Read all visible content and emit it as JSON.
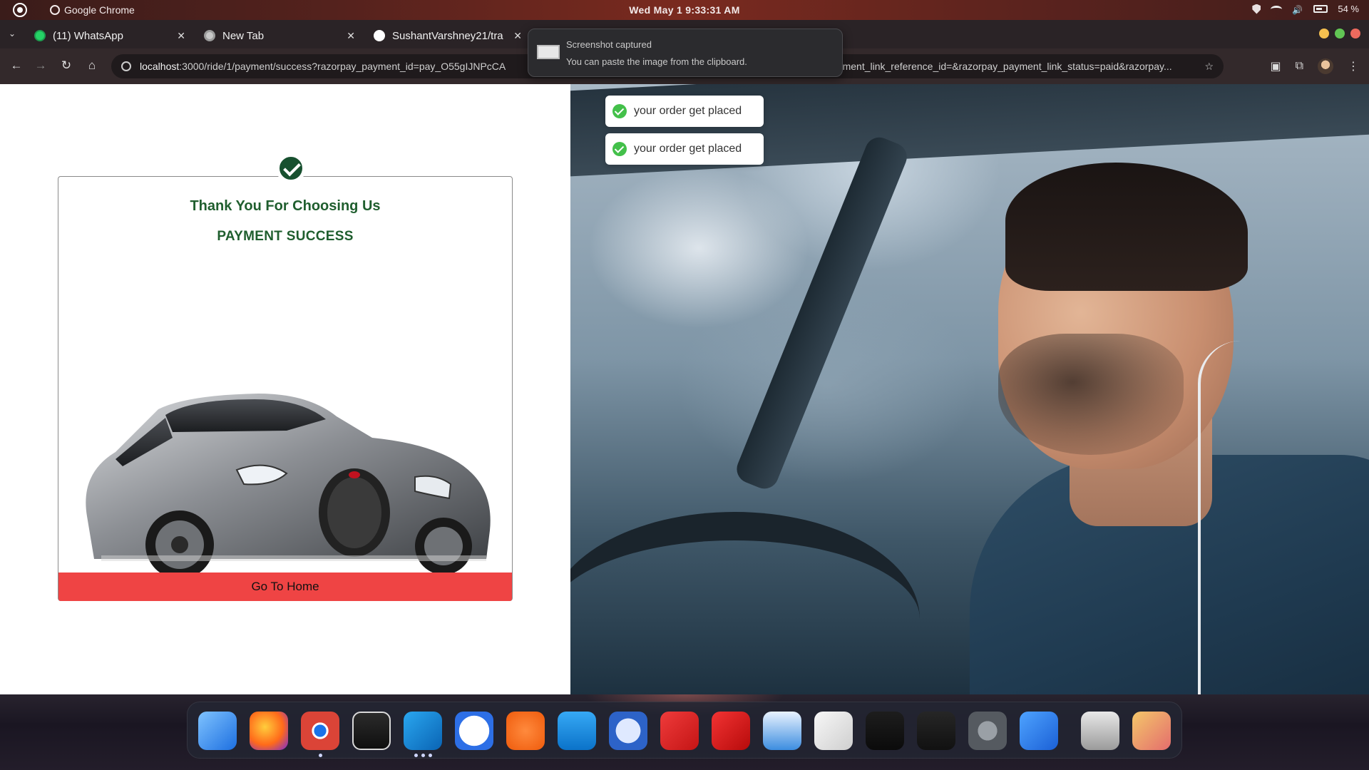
{
  "os_bar": {
    "app_name": "Google Chrome",
    "clock": "Wed May 1  9:33:31 AM",
    "battery": "54 %"
  },
  "tabs": [
    {
      "title": "(11) WhatsApp",
      "icon": "whatsapp-icon"
    },
    {
      "title": "New Tab",
      "icon": "chrome-icon"
    },
    {
      "title": "SushantVarshney21/tra",
      "icon": "github-icon"
    }
  ],
  "address_bar": {
    "url_host": "localhost",
    "url_path_start": ":3000/ride/1/payment/success?razorpay_payment_id=pay_O55gIJNPcCA",
    "url_path_end": "_payment_link_reference_id=&razorpay_payment_link_status=paid&razorpay..."
  },
  "notification": {
    "title": "Screenshot captured",
    "body": "You can paste the image from the clipboard."
  },
  "toasts": [
    {
      "text": "your order get placed"
    },
    {
      "text": "your order get placed"
    }
  ],
  "success_card": {
    "thanks": "Thank You For Choosing Us",
    "status": "PAYMENT SUCCESS",
    "home_button": "Go To Home"
  },
  "colors": {
    "success_green": "#1f5e2e",
    "button_red": "#ef4444",
    "toast_check": "#43c04a"
  },
  "dock_apps": [
    "finder-icon",
    "firefox-icon",
    "chrome-icon",
    "terminal-icon",
    "vscode-icon",
    "app-installer-icon",
    "postman-icon",
    "docker-icon",
    "thunderbird-icon",
    "anydesk-icon",
    "acrobat-icon",
    "document-viewer-icon",
    "text-editor-icon",
    "system-monitor-icon",
    "activity-monitor-icon",
    "settings-icon",
    "software-updater-icon",
    "trash-icon",
    "app-grid-icon"
  ]
}
